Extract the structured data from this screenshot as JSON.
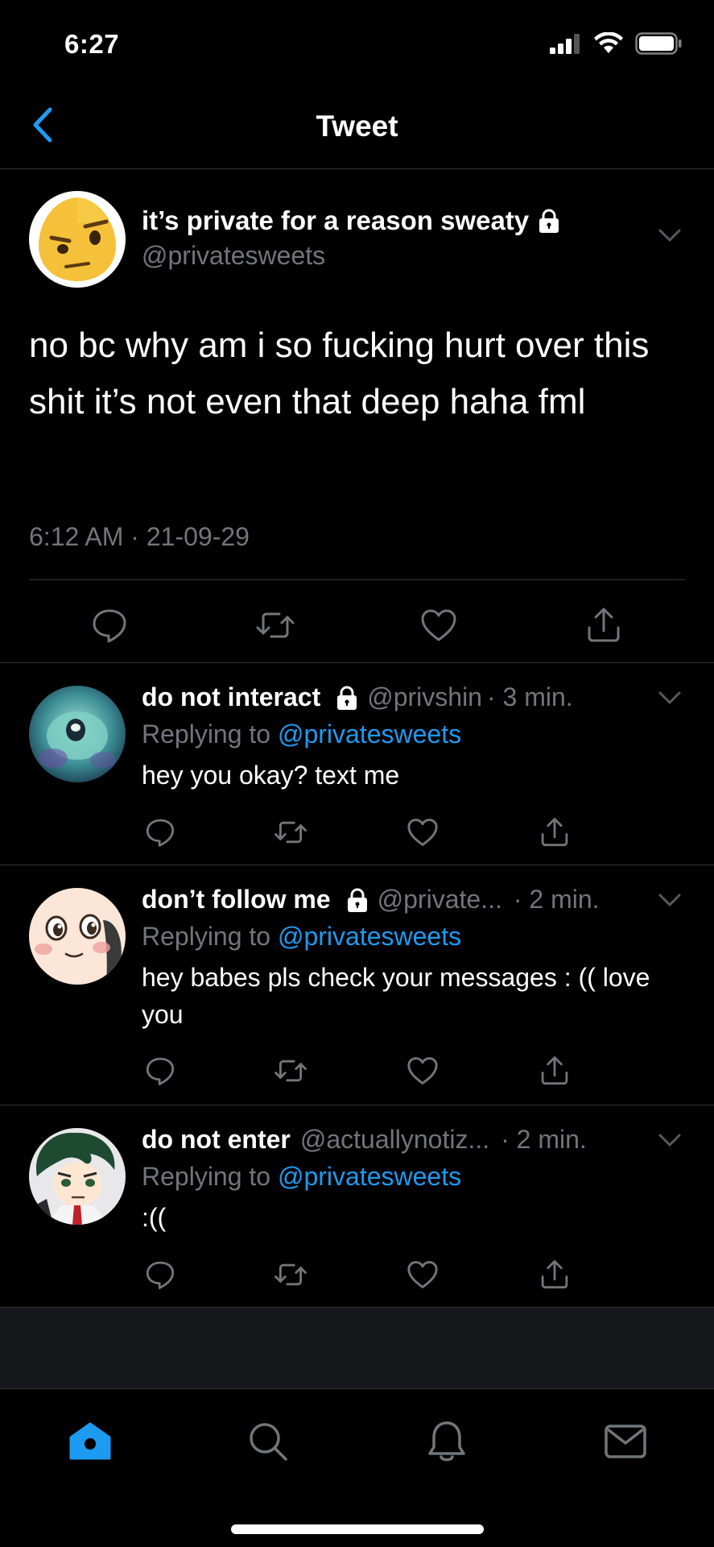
{
  "status_bar": {
    "time": "6:27"
  },
  "nav": {
    "title": "Tweet"
  },
  "main_tweet": {
    "display_name": "it’s private for a reason sweaty",
    "handle": "@privatesweets",
    "text": "no bc why am i so fucking hurt over this shit it’s not even that deep haha fml",
    "timestamp": "6:12 AM · 21-09-29",
    "avatar_icon": "sly-face-emoji-avatar"
  },
  "replies": [
    {
      "display_name": "do not interact",
      "handle": "@privshin",
      "time": "· 3 min.",
      "locked": true,
      "replying_prefix": "Replying to",
      "replying_to": "@privatesweets",
      "text": "hey you okay? text me",
      "avatar_icon": "alien-creature-avatar"
    },
    {
      "display_name": "don’t follow me",
      "handle": "@private...",
      "time": "· 2 min.",
      "locked": true,
      "replying_prefix": "Replying to",
      "replying_to": "@privatesweets",
      "text": "hey babes pls check your messages : (( love you",
      "avatar_icon": "anime-face-avatar"
    },
    {
      "display_name": "do not enter",
      "handle": "@actuallynotiz...",
      "time": "· 2 min.",
      "locked": false,
      "replying_prefix": "Replying to",
      "replying_to": "@privatesweets",
      "text": ":((",
      "avatar_icon": "anime-boy-avatar"
    }
  ],
  "tab_bar": {
    "tabs": [
      "home-icon",
      "search-icon",
      "notifications-icon",
      "messages-icon"
    ],
    "active": "home"
  },
  "colors": {
    "background": "#000000",
    "accent": "#1d9bf0",
    "secondary_text": "#71767b",
    "divider": "#2f3336"
  }
}
